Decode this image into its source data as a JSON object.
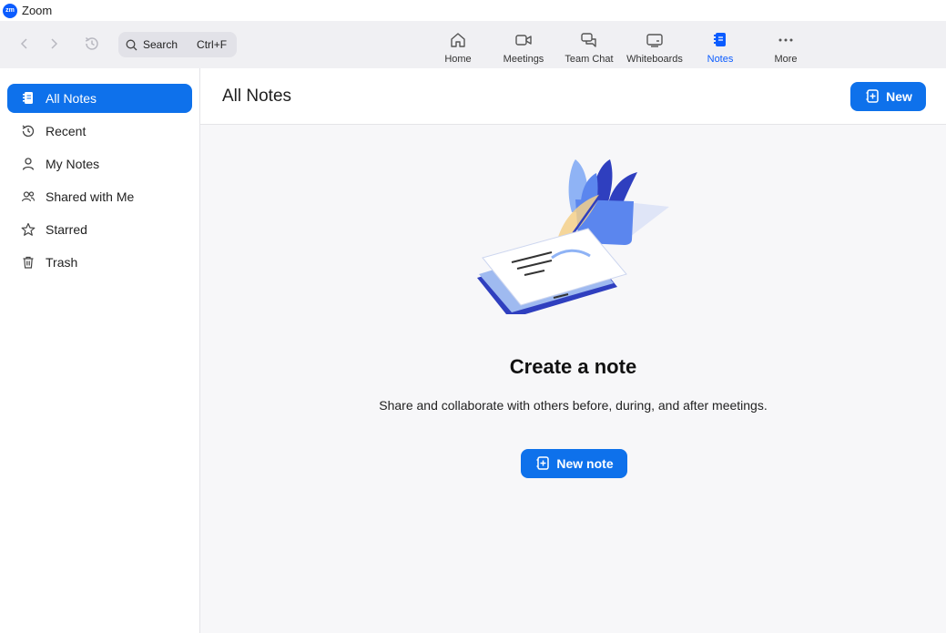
{
  "app": {
    "logo_text": "zm",
    "title": "Zoom"
  },
  "toolbar": {
    "search": {
      "label": "Search",
      "shortcut": "Ctrl+F"
    },
    "tabs": [
      {
        "label": "Home",
        "icon": "home-icon"
      },
      {
        "label": "Meetings",
        "icon": "video-camera-icon"
      },
      {
        "label": "Team Chat",
        "icon": "chat-bubbles-icon"
      },
      {
        "label": "Whiteboards",
        "icon": "whiteboard-icon"
      },
      {
        "label": "Notes",
        "icon": "notes-icon",
        "active": true
      },
      {
        "label": "More",
        "icon": "more-dots-icon"
      }
    ]
  },
  "sidebar": {
    "items": [
      {
        "label": "All Notes",
        "icon": "notes-icon",
        "active": true
      },
      {
        "label": "Recent",
        "icon": "clock-history-icon"
      },
      {
        "label": "My Notes",
        "icon": "person-icon"
      },
      {
        "label": "Shared with Me",
        "icon": "people-icon"
      },
      {
        "label": "Starred",
        "icon": "star-icon"
      },
      {
        "label": "Trash",
        "icon": "trash-icon"
      }
    ]
  },
  "main": {
    "title": "All Notes",
    "new_button_label": "New",
    "empty_state": {
      "title": "Create a note",
      "description": "Share and collaborate with others before, during, and after meetings.",
      "button_label": "New note"
    }
  },
  "colors": {
    "accent": "#0e71eb",
    "toolbar_bg": "#f0f0f3",
    "body_bg": "#f7f7f9"
  }
}
